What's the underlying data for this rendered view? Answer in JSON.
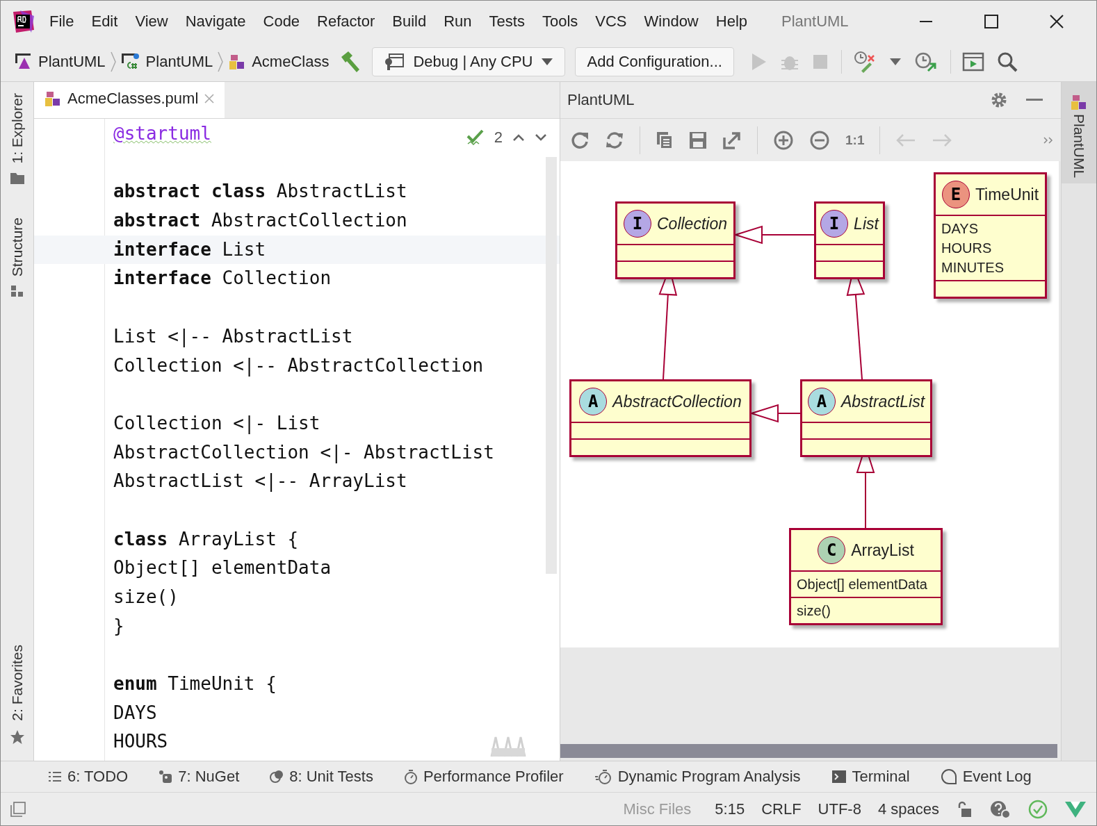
{
  "window": {
    "title": "PlantUML"
  },
  "menu": [
    "File",
    "Edit",
    "View",
    "Navigate",
    "Code",
    "Refactor",
    "Build",
    "Run",
    "Tests",
    "Tools",
    "VCS",
    "Window",
    "Help"
  ],
  "breadcrumbs": [
    {
      "label": "PlantUML",
      "kind": "solution"
    },
    {
      "label": "PlantUML",
      "kind": "project"
    },
    {
      "label": "AcmeClass",
      "kind": "file"
    }
  ],
  "run_config": {
    "label": "Debug | Any CPU"
  },
  "add_configuration": {
    "label": "Add Configuration..."
  },
  "left_tool_tabs": [
    {
      "label": "1: Explorer",
      "kind": "folder"
    },
    {
      "label": "Structure",
      "kind": "structure"
    },
    {
      "label": "2: Favorites",
      "kind": "star"
    }
  ],
  "editor": {
    "tab": {
      "label": "AcmeClasses.puml",
      "selected": true
    },
    "inspection": {
      "count": "2"
    },
    "blocks": [
      [
        {
          "text": "@startuml",
          "kind": "directive",
          "current": false
        }
      ],
      [
        {
          "text": "**abstract class** AbstractList",
          "kind": "code",
          "current": false
        },
        {
          "text": "**abstract** AbstractCollection",
          "kind": "code",
          "current": false
        },
        {
          "text": "**interface** List",
          "kind": "code",
          "current": true
        },
        {
          "text": "**interface** Collection",
          "kind": "code",
          "current": false
        }
      ],
      [
        {
          "text": "List <|-- AbstractList",
          "kind": "code",
          "current": false
        },
        {
          "text": "Collection <|-- AbstractCollection",
          "kind": "code",
          "current": false
        }
      ],
      [
        {
          "text": "Collection <|- List",
          "kind": "code",
          "current": false
        },
        {
          "text": "AbstractCollection <|- AbstractList",
          "kind": "code",
          "current": false
        },
        {
          "text": "AbstractList <|-- ArrayList",
          "kind": "code",
          "current": false
        }
      ],
      [
        {
          "text": "**class** ArrayList {",
          "kind": "code",
          "current": false
        },
        {
          "text": "Object[] elementData",
          "kind": "code",
          "current": false
        },
        {
          "text": "size()",
          "kind": "code",
          "current": false
        },
        {
          "text": "}",
          "kind": "code",
          "current": false
        }
      ],
      [
        {
          "text": "**enum** TimeUnit {",
          "kind": "code",
          "current": false
        },
        {
          "text": "DAYS",
          "kind": "code",
          "current": false
        },
        {
          "text": "HOURS",
          "kind": "code",
          "current": false
        }
      ]
    ]
  },
  "plantuml_panel": {
    "title": "PlantUML",
    "actual_size": "1:1",
    "classes": [
      {
        "name": "Collection",
        "kind": "interface",
        "letter": "I"
      },
      {
        "name": "List",
        "kind": "interface",
        "letter": "I"
      },
      {
        "name": "TimeUnit",
        "kind": "enum",
        "letter": "E",
        "fields": [
          "DAYS",
          "HOURS",
          "MINUTES"
        ]
      },
      {
        "name": "AbstractCollection",
        "kind": "abstract",
        "letter": "A"
      },
      {
        "name": "AbstractList",
        "kind": "abstract",
        "letter": "A"
      },
      {
        "name": "ArrayList",
        "kind": "class",
        "letter": "C",
        "fields": [
          "Object[] elementData"
        ],
        "methods": [
          "size()"
        ]
      }
    ]
  },
  "right_tool_tabs": [
    {
      "label": "PlantUML"
    }
  ],
  "tool_windows": [
    {
      "label": "6: TODO",
      "kind": "todo"
    },
    {
      "label": "7: NuGet",
      "kind": "nuget"
    },
    {
      "label": "8: Unit Tests",
      "kind": "tests"
    },
    {
      "label": "Performance Profiler",
      "kind": "profiler"
    },
    {
      "label": "Dynamic Program Analysis",
      "kind": "analysis"
    },
    {
      "label": "Terminal",
      "kind": "terminal"
    },
    {
      "label": "Event Log",
      "kind": "log"
    }
  ],
  "status_bar": [
    {
      "text": "Misc Files",
      "disabled": true
    },
    {
      "text": "5:15",
      "disabled": false
    },
    {
      "text": "CRLF",
      "disabled": false
    },
    {
      "text": "UTF-8",
      "disabled": false
    },
    {
      "text": "4 spaces",
      "disabled": false
    }
  ]
}
